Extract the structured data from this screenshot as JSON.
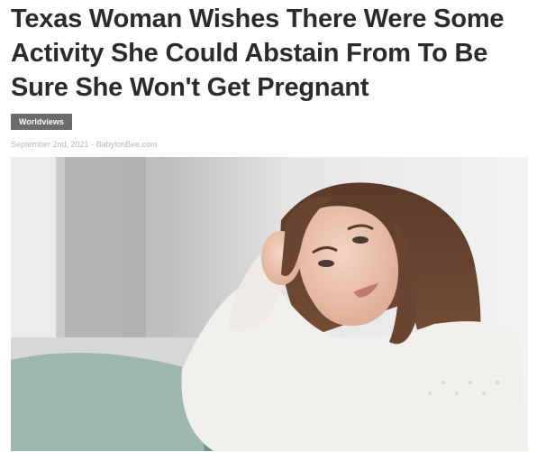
{
  "article": {
    "headline": "Texas Woman Wishes There Were Some Activity She Could Abstain From To Be Sure She Won't Get Pregnant",
    "category": "Worldviews",
    "date": "September 2nd, 2021",
    "separator": " - ",
    "source": "BabylonBee.com"
  },
  "colors": {
    "headline": "#2b2b2b",
    "badge_bg": "#6b6b6b",
    "byline": "#b8b8b8"
  },
  "image": {
    "subject": "pensive young woman with long brown hair resting head on hand, wearing white knit sweater, leaning on teal pillow"
  }
}
